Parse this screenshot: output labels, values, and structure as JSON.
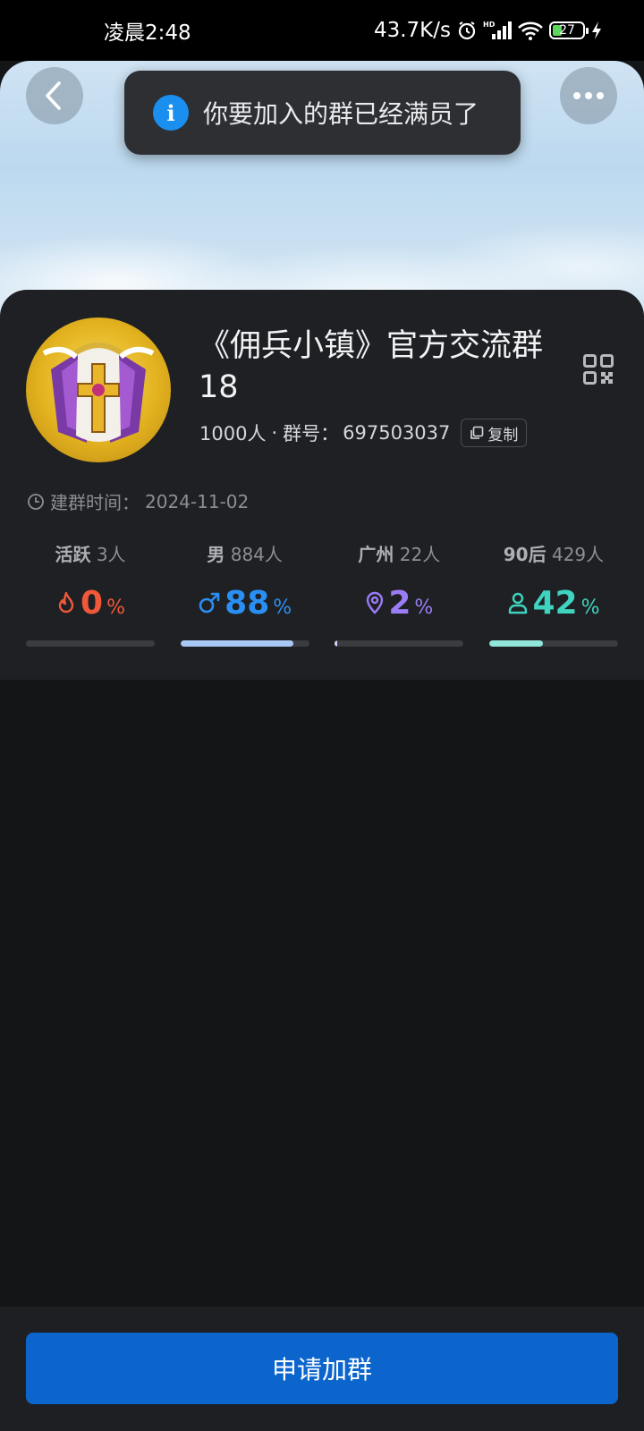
{
  "status_bar": {
    "time": "凌晨2:48",
    "network_speed": "43.7K/s",
    "battery": "27",
    "icons": [
      "alarm-icon",
      "hd-signal-icon",
      "wifi-icon",
      "battery-icon",
      "charging-icon"
    ]
  },
  "toast": {
    "icon": "info-icon",
    "message": "你要加入的群已经满员了"
  },
  "group": {
    "name": "《佣兵小镇》官方交流群18",
    "members": "1000人",
    "separator": "·",
    "number_label": "群号：",
    "number": "697503037",
    "copy_label": "复制",
    "created_label": "建群时间：",
    "created_date": "2024-11-02"
  },
  "stats": [
    {
      "label": "活跃",
      "count": "3人",
      "value": "0",
      "unit": "%",
      "icon": "flame-icon",
      "color": "#f0583a",
      "fill": 0
    },
    {
      "label": "男",
      "count": "884人",
      "value": "88",
      "unit": "%",
      "icon": "male-icon",
      "color": "#2a8ff2",
      "fill": 0.88,
      "bar_color": "#a8c8f5"
    },
    {
      "label": "广州",
      "count": "22人",
      "value": "2",
      "unit": "%",
      "icon": "location-pin-icon",
      "color": "#9a7cf5",
      "fill": 0.02,
      "bar_color": "#d8d0ff"
    },
    {
      "label": "90后",
      "count": "429人",
      "value": "42",
      "unit": "%",
      "icon": "person-icon",
      "color": "#3fd3c0",
      "fill": 0.42,
      "bar_color": "#8fe6d9"
    }
  ],
  "actions": {
    "join_label": "申请加群"
  }
}
